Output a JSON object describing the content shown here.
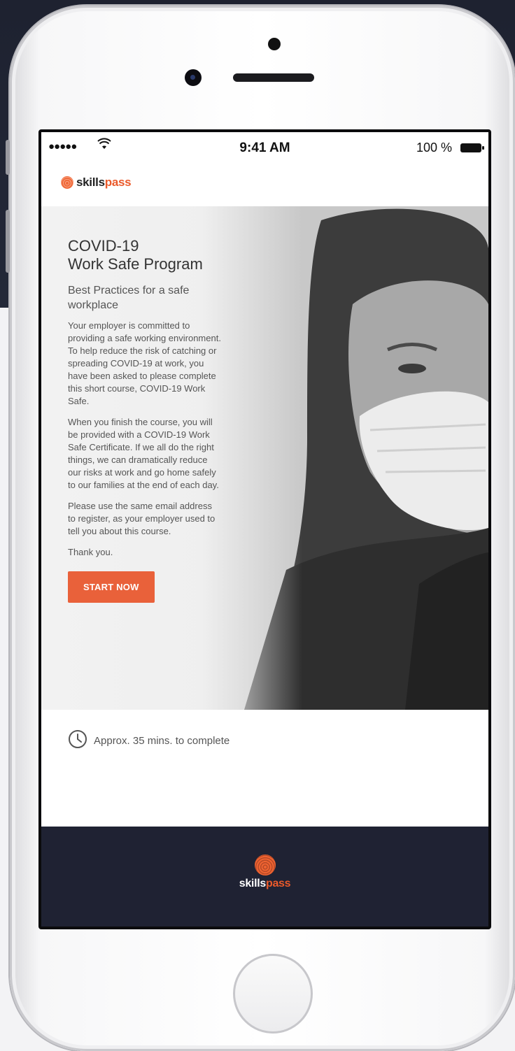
{
  "status_bar": {
    "signal": "●●●●●",
    "time": "9:41 AM",
    "battery_pct": "100 %"
  },
  "brand": {
    "name_prefix": "skills",
    "name_suffix": "pass",
    "accent": "#ea5a2b"
  },
  "hero": {
    "title_line1": "COVID-19",
    "title_line2": "Work Safe Program",
    "subtitle": "Best Practices for a safe workplace",
    "para1": "Your employer is committed to providing a safe working environment.  To help reduce the risk of catching or spreading COVID-19 at work, you have been asked to please complete this short course, COVID-19 Work Safe.",
    "para2": "When you finish the course, you will be provided with a COVID-19 Work Safe Certificate. If we all do the right things, we can dramatically reduce our risks at work and go home safely to our families at the end of each day.",
    "para3": "Please use the same email address to register, as your employer used to tell you about this course.",
    "para4": "Thank you.",
    "start_button": "START NOW"
  },
  "duration": {
    "icon": "clock-icon",
    "label": "Approx. 35 mins. to complete"
  },
  "footer": {
    "bg": "#1f2233"
  }
}
